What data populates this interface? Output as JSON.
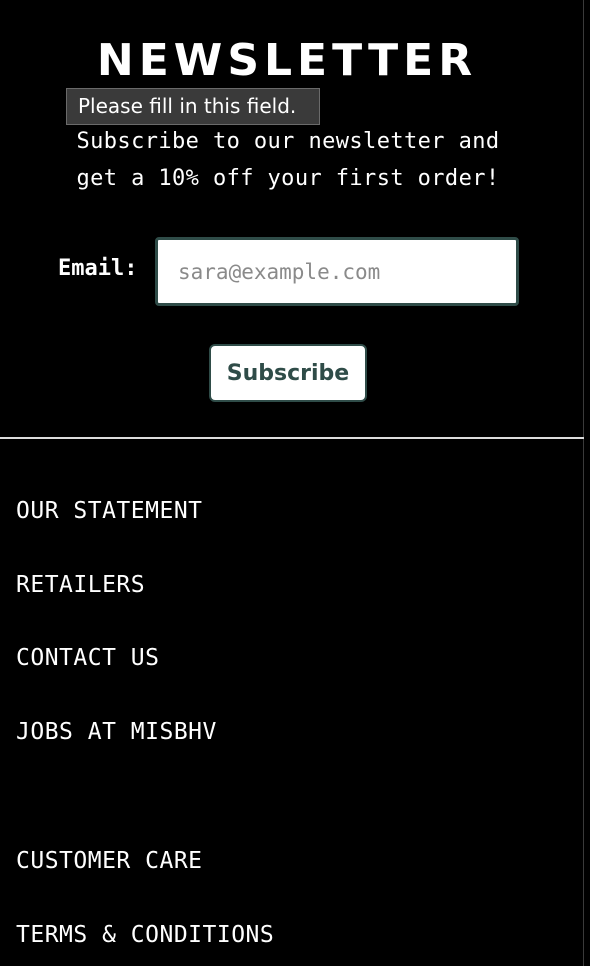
{
  "newsletter": {
    "title": "NEWSLETTER",
    "tooltip": "Please fill in this field.",
    "subtitle_line1": "Subscribe to our newsletter and",
    "subtitle_line2": "get a 10% off your first order!",
    "email_label": "Email:",
    "email_value": "",
    "email_placeholder": "sara@example.com",
    "subscribe_label": "Subscribe"
  },
  "footer": {
    "links": [
      "OUR STATEMENT",
      "RETAILERS",
      "CONTACT US",
      "JOBS AT MISBHV",
      "CUSTOMER CARE",
      "TERMS & CONDITIONS"
    ]
  },
  "colors": {
    "background": "#000000",
    "accent": "#2f4c48",
    "divider": "#dcdcdc",
    "tooltip_bg": "#3a3a3a"
  }
}
